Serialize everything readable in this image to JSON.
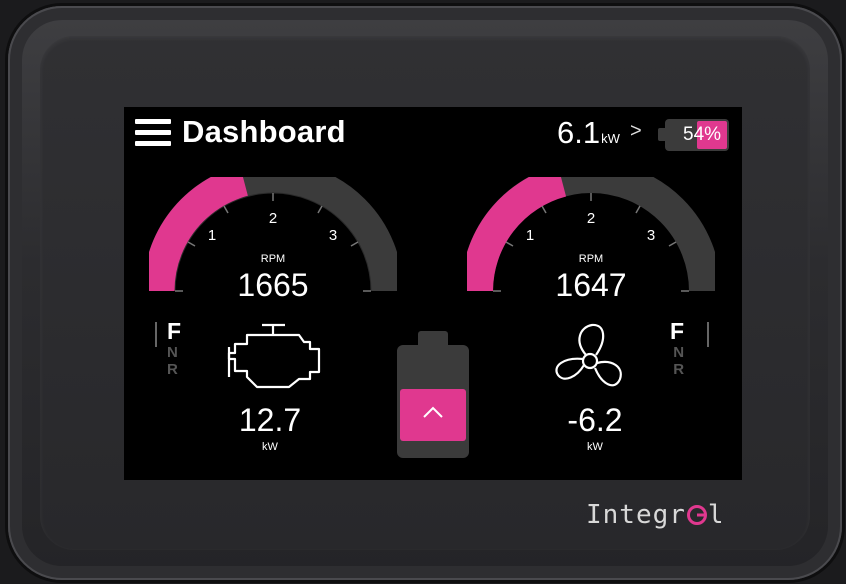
{
  "header": {
    "title": "Dashboard",
    "power_value": "6.1",
    "power_unit": "kW",
    "chevron": ">",
    "battery_percent": "54%"
  },
  "left_panel": {
    "gauge_label": "RPM",
    "rpm": "1665",
    "rpm_fraction": 0.35,
    "tick_labels": [
      "1",
      "2",
      "3"
    ],
    "gears": [
      "F",
      "N",
      "R"
    ],
    "active_gear": "F",
    "power_value": "12.7",
    "power_unit": "kW",
    "icon": "engine-icon"
  },
  "right_panel": {
    "gauge_label": "RPM",
    "rpm": "1647",
    "rpm_fraction": 0.35,
    "tick_labels": [
      "1",
      "2",
      "3"
    ],
    "gears": [
      "F",
      "N",
      "R"
    ],
    "active_gear": "F",
    "power_value": "-6.2",
    "power_unit": "kW",
    "icon": "propeller-icon"
  },
  "center": {
    "icon": "battery-icon",
    "button_icon": "chevron-up-icon"
  },
  "branding": {
    "text_before": "Integr",
    "text_after": "l"
  },
  "colors": {
    "accent": "#e0388f",
    "screen_bg": "#000000",
    "track": "#3b3b3b",
    "text": "#ffffff"
  }
}
